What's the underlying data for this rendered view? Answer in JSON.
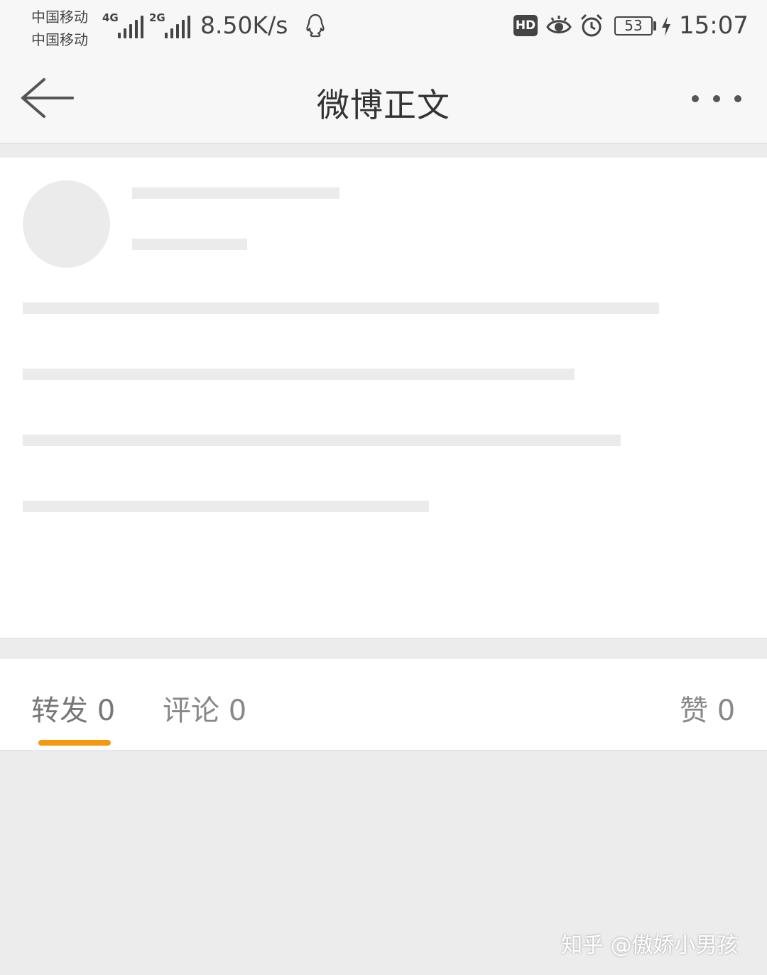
{
  "status_bar": {
    "carrier_1": "中国移动",
    "carrier_2": "中国移动",
    "network_1": "4G",
    "network_2": "2G",
    "speed": "8.50K/s",
    "hd_label": "HD",
    "battery_level": "53",
    "time": "15:07",
    "icons": [
      "signal-icon",
      "qq-icon",
      "eye-icon",
      "alarm-icon",
      "battery-icon",
      "charging-icon"
    ]
  },
  "nav": {
    "title": "微博正文",
    "back_icon": "back-arrow-icon",
    "more_icon": "more-dots-icon"
  },
  "tabs": {
    "repost": "转发 0",
    "comment": "评论 0",
    "like": "赞 0",
    "active": "repost",
    "accent_color": "#f39a0c"
  },
  "watermark": "知乎 @傲娇小男孩"
}
